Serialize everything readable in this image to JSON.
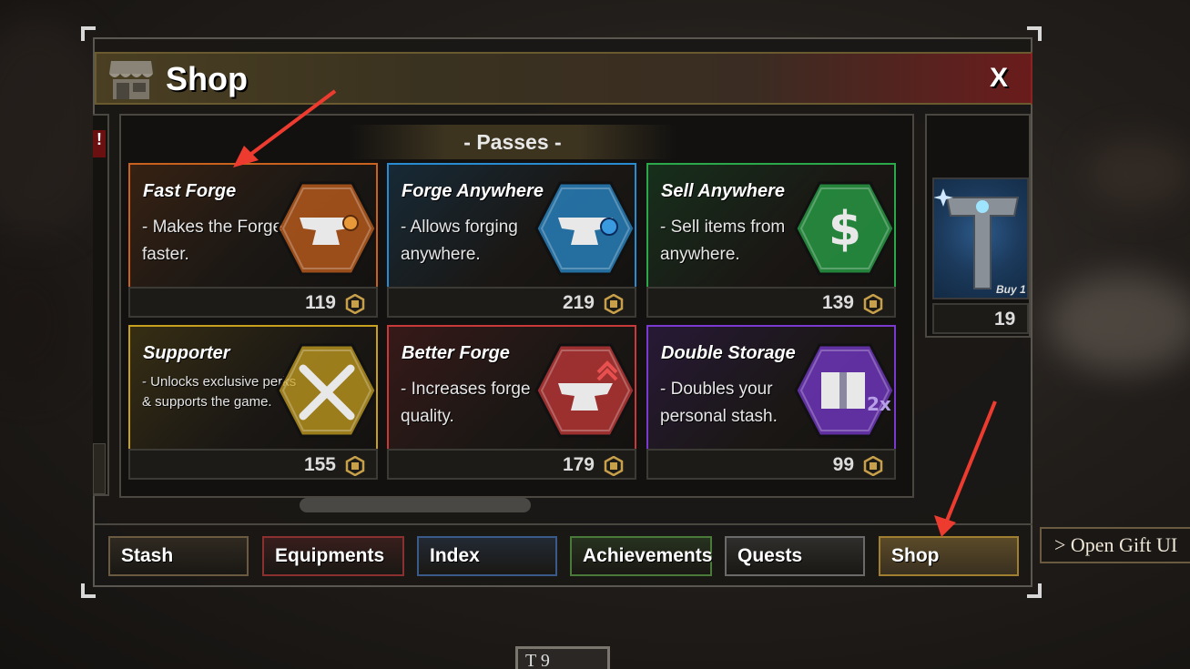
{
  "window": {
    "title": "Shop",
    "close_label": "X"
  },
  "section": {
    "title": "- Passes -"
  },
  "side_left": {
    "tag": "!"
  },
  "passes": [
    {
      "name": "Fast Forge",
      "desc": "- Makes the Forge faster.",
      "price": "119",
      "color": "#c8621e",
      "icon": "anvil-clock-icon"
    },
    {
      "name": "Forge Anywhere",
      "desc": "- Allows forging anywhere.",
      "price": "219",
      "color": "#2a8cd0",
      "icon": "anvil-globe-icon"
    },
    {
      "name": "Sell Anywhere",
      "desc": "- Sell items from anywhere.",
      "price": "139",
      "color": "#2aa84a",
      "icon": "dollar-icon"
    },
    {
      "name": "Supporter",
      "desc": "- Unlocks exclusive perks & supports the game.",
      "price": "155",
      "color": "#c8a020",
      "icon": "crossed-swords-icon"
    },
    {
      "name": "Better Forge",
      "desc": "- Increases forge quality.",
      "price": "179",
      "color": "#c83a3a",
      "icon": "anvil-up-icon"
    },
    {
      "name": "Double Storage",
      "desc": "- Doubles your personal stash.",
      "price": "99",
      "color": "#7a3ad0",
      "icon": "chest-2x-icon"
    }
  ],
  "side_item": {
    "badge": "Buy 1",
    "price": "19"
  },
  "tabs": [
    {
      "label": "Stash",
      "color": "#6a5a40"
    },
    {
      "label": "Equipments",
      "color": "#8a3030"
    },
    {
      "label": "Index",
      "color": "#3a5a8a"
    },
    {
      "label": "Achievements",
      "color": "#4a7a3a"
    },
    {
      "label": "Quests",
      "color": "#6a6a6a"
    },
    {
      "label": "Shop",
      "color": "#a08030"
    }
  ],
  "gift_button": "> Open Gift UI",
  "hud_label": "T  9"
}
